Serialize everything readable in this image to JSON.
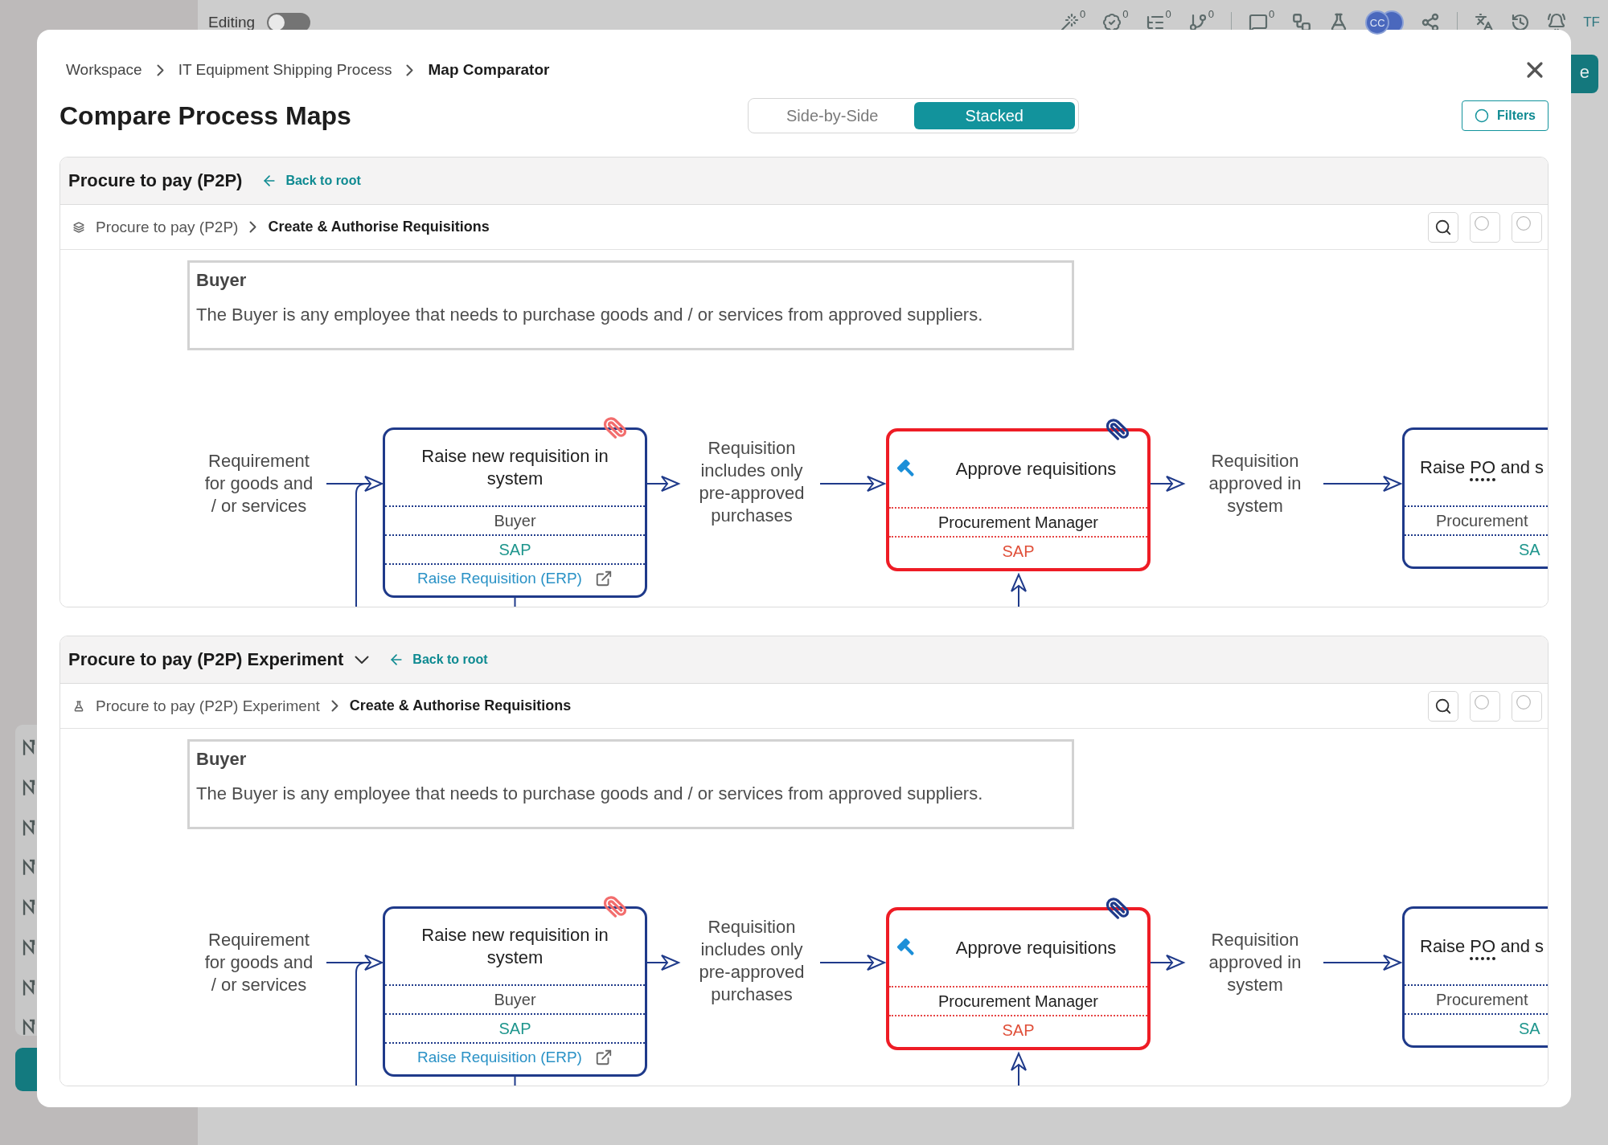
{
  "app_bar": {
    "editing": {
      "label": "Editing",
      "on": false
    },
    "counters": [
      "0",
      "0",
      "0",
      "0",
      "0"
    ],
    "avatar": "CC",
    "initials": "TF",
    "corner_button": "e"
  },
  "modal": {
    "breadcrumb": [
      {
        "label": "Workspace",
        "current": false
      },
      {
        "label": "IT Equipment Shipping Process",
        "current": false
      },
      {
        "label": "Map Comparator",
        "current": true
      }
    ],
    "title": "Compare Process Maps",
    "view_modes": [
      {
        "label": "Side-by-Side",
        "selected": false
      },
      {
        "label": "Stacked",
        "selected": true
      }
    ],
    "filters_button": "Filters",
    "panels": [
      {
        "kind": "map",
        "title": "Procure to pay (P2P)",
        "dropdown": false,
        "back_link": "Back to root",
        "path": [
          {
            "label": "Procure to pay (P2P)",
            "current": false
          },
          {
            "label": "Create & Authorise Requisitions",
            "current": true
          }
        ],
        "lane": {
          "title": "Buyer",
          "description": "The Buyer is any employee that needs to purchase goods and / or services from approved suppliers."
        },
        "flow": [
          {
            "kind": "event",
            "text": "Requirement for goods and / or services"
          },
          {
            "kind": "task",
            "title": [
              {
                "text": "Raise new requisition in system",
                "abbreviation": false
              }
            ],
            "changed": false,
            "icon": false,
            "attachment": {
              "color": "#f26d6d"
            },
            "role": "Buyer",
            "system": "SAP",
            "link": "Raise Requisition (ERP)"
          },
          {
            "kind": "event",
            "text": "Requisition includes only pre-approved purchases"
          },
          {
            "kind": "task",
            "title": [
              {
                "text": "Approve requisitions",
                "abbreviation": false
              }
            ],
            "changed": true,
            "icon": true,
            "attachment": {
              "color": "#1f3a8a"
            },
            "role": "Procurement Manager",
            "system": "SAP"
          },
          {
            "kind": "event",
            "text": "Requisition approved in system"
          },
          {
            "kind": "task",
            "title": [
              {
                "text": "Raise ",
                "abbreviation": false
              },
              {
                "text": "PO",
                "abbreviation": true
              },
              {
                "text": " and s",
                "abbreviation": false
              }
            ],
            "changed": false,
            "icon": false,
            "role": "Procurement",
            "system": "SA"
          }
        ]
      },
      {
        "kind": "experiment",
        "title": "Procure to pay (P2P) Experiment",
        "dropdown": true,
        "back_link": "Back to root",
        "path": [
          {
            "label": "Procure to pay (P2P) Experiment",
            "current": false
          },
          {
            "label": "Create & Authorise Requisitions",
            "current": true
          }
        ],
        "lane": {
          "title": "Buyer",
          "description": "The Buyer is any employee that needs to purchase goods and / or services from approved suppliers."
        },
        "flow": [
          {
            "kind": "event",
            "text": "Requirement for goods and / or services"
          },
          {
            "kind": "task",
            "title": [
              {
                "text": "Raise new requisition in system",
                "abbreviation": false
              }
            ],
            "changed": false,
            "icon": false,
            "attachment": {
              "color": "#f26d6d"
            },
            "role": "Buyer",
            "system": "SAP",
            "link": "Raise Requisition (ERP)"
          },
          {
            "kind": "event",
            "text": "Requisition includes only pre-approved purchases"
          },
          {
            "kind": "task",
            "title": [
              {
                "text": "Approve requisitions",
                "abbreviation": false
              }
            ],
            "changed": true,
            "icon": true,
            "attachment": {
              "color": "#1f3a8a"
            },
            "role": "Procurement Manager",
            "system": "SAP"
          },
          {
            "kind": "event",
            "text": "Requisition approved in system"
          },
          {
            "kind": "task",
            "title": [
              {
                "text": "Raise ",
                "abbreviation": false
              },
              {
                "text": "PO",
                "abbreviation": true
              },
              {
                "text": " and s",
                "abbreviation": false
              }
            ],
            "changed": false,
            "icon": false,
            "role": "Procurement",
            "system": "SA"
          }
        ]
      }
    ]
  }
}
